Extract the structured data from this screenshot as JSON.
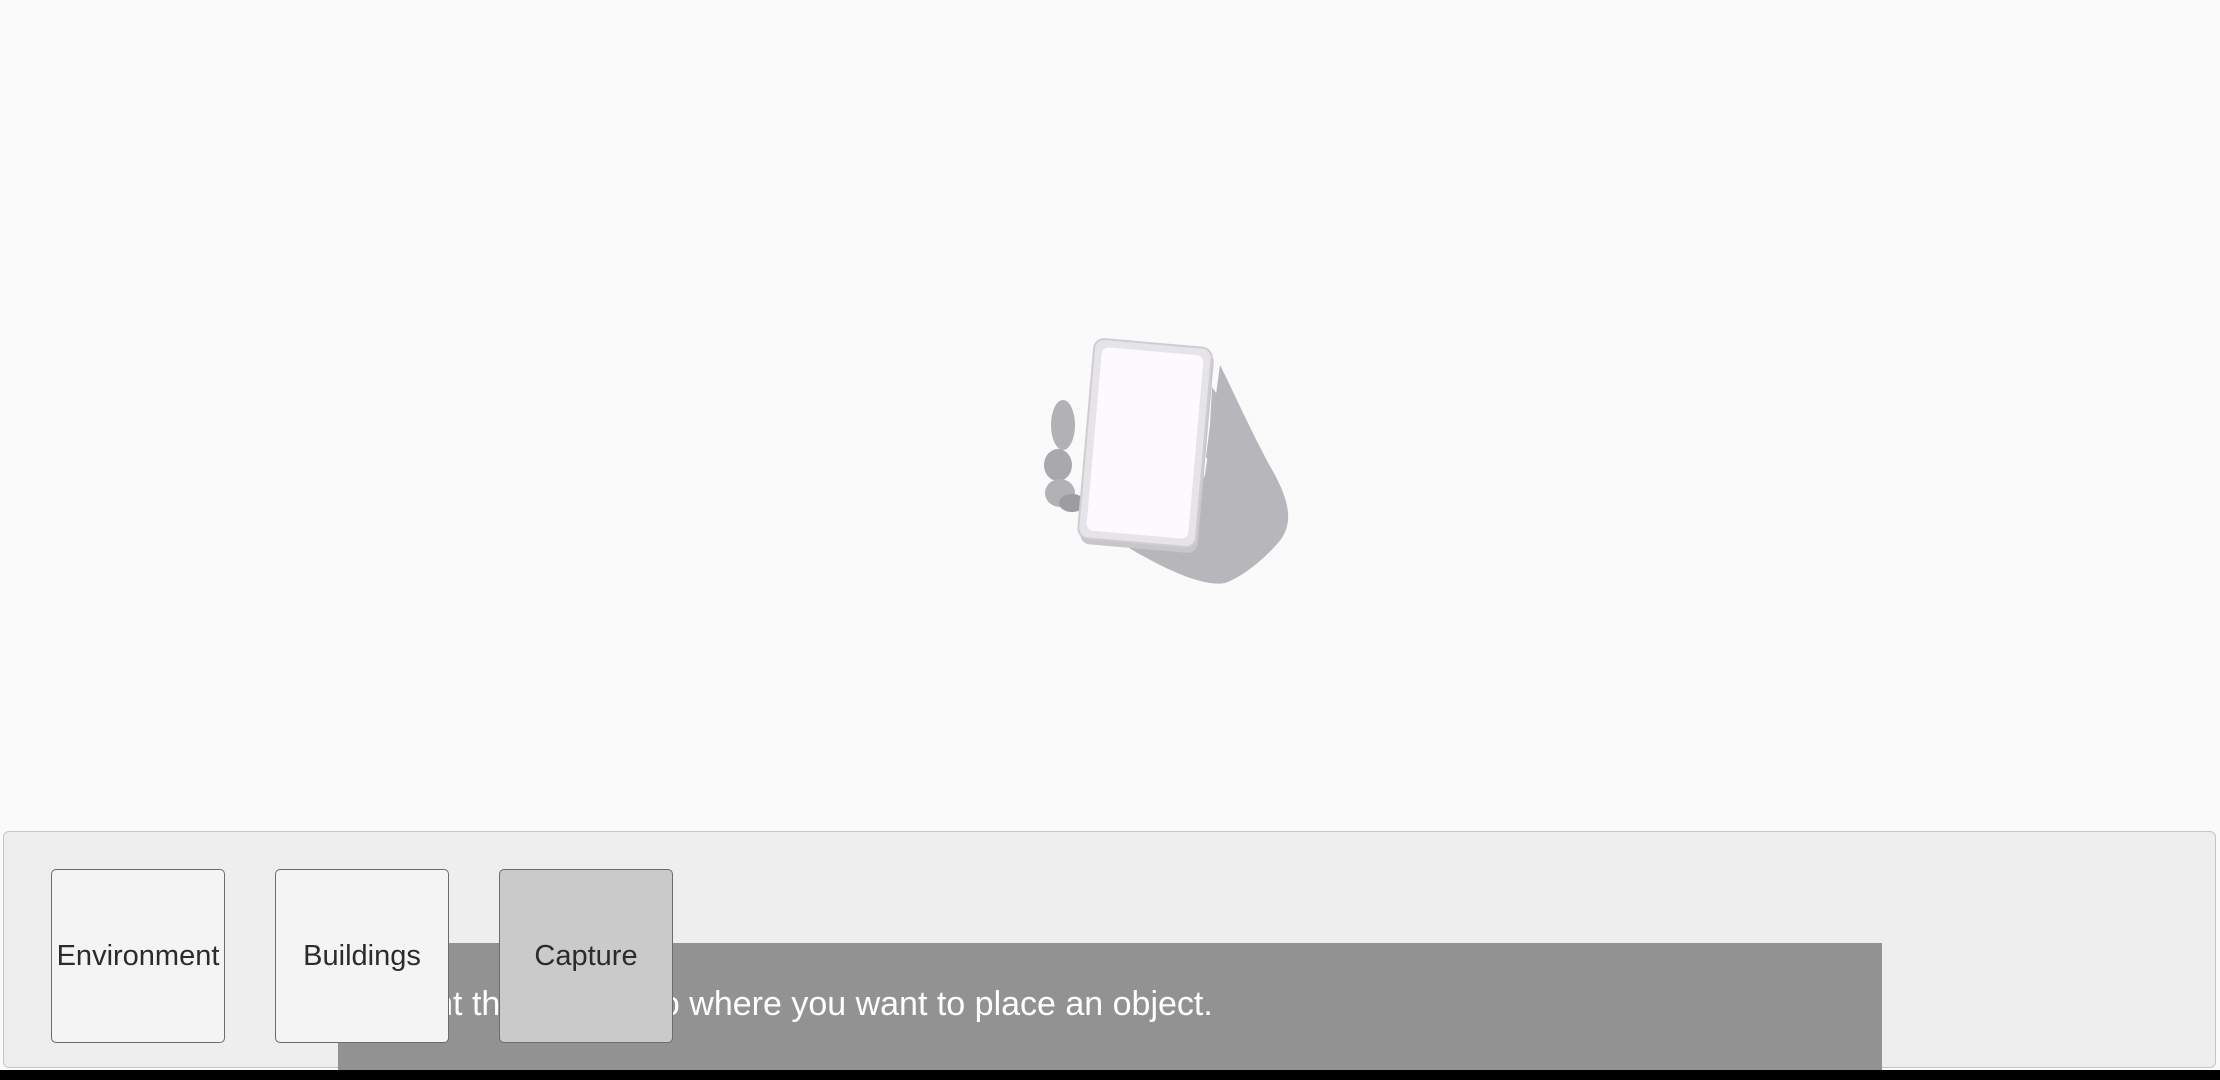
{
  "instruction": {
    "text": "Point the camera to where you want to place an object."
  },
  "tabs": [
    {
      "label": "Environment",
      "selected": false
    },
    {
      "label": "Buildings",
      "selected": false
    },
    {
      "label": "Capture",
      "selected": true
    }
  ],
  "colors": {
    "background": "#fafafa",
    "panel": "#eeeeee",
    "banner": "#929292",
    "selected_tab": "#cacaca",
    "tab": "#f4f4f4"
  },
  "icons": {
    "illustration": "hand-holding-phone-icon"
  }
}
